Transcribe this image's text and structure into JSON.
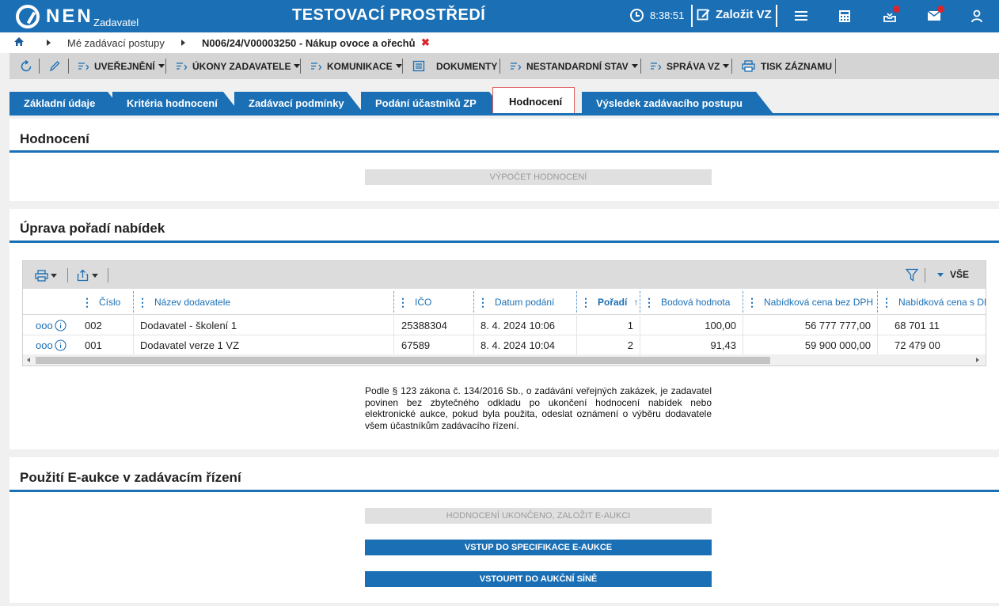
{
  "app": {
    "logo_text": "NEN",
    "logo_sub": "Zadavatel",
    "env_title": "TESTOVACÍ PROSTŘEDÍ",
    "clock": "8:38:51",
    "new_button": "Založit VZ"
  },
  "icons": [
    "clock-icon",
    "edit-icon",
    "menu-icon",
    "calculator-icon",
    "inbox-icon",
    "mail-icon",
    "user-icon",
    "home-icon",
    "refresh-icon",
    "pencil-icon",
    "printer-icon",
    "export-icon",
    "filter-icon",
    "info-icon",
    "more-icon"
  ],
  "colors": {
    "primary": "#1a6fb5",
    "notification": "#d9262c",
    "close": "#d9262c"
  },
  "breadcrumb": {
    "item1": "Mé zadávací postupy",
    "item2": "N006/24/V00003250 - Nákup ovoce a ořechů",
    "close": "✖"
  },
  "toolbar": {
    "uverejneni": "UVEŘEJNĚNÍ",
    "ukony": "ÚKONY ZADAVATELE",
    "komunikace": "KOMUNIKACE",
    "dokumenty": "DOKUMENTY",
    "nestandardni": "NESTANDARDNÍ STAV",
    "sprava": "SPRÁVA VZ",
    "tisk": "TISK ZÁZNAMU"
  },
  "tabs": [
    {
      "label": "Základní údaje"
    },
    {
      "label": "Kritéria hodnocení"
    },
    {
      "label": "Zadávací podmínky"
    },
    {
      "label": "Podání účastníků ZP"
    },
    {
      "label": "Hodnocení",
      "active": true
    },
    {
      "label": "Výsledek zadávacího postupu"
    }
  ],
  "section_hodnoceni": {
    "title": "Hodnocení",
    "button": "VÝPOČET HODNOCENÍ"
  },
  "section_poradi": {
    "title": "Úprava pořadí nabídek",
    "filter_label": "VŠE",
    "columns": [
      "Číslo",
      "Název dodavatele",
      "IČO",
      "Datum podání",
      "Pořadí",
      "Bodová hodnota",
      "Nabídková cena bez DPH",
      "Nabídková cena s DPH"
    ],
    "sort_indicator": "↑",
    "rows": [
      [
        "002",
        "Dodavatel - školení 1",
        "25388304",
        "8. 4. 2024 10:06",
        "1",
        "100,00",
        "56 777 777,00",
        "68 701 11"
      ],
      [
        "001",
        "Dodavatel verze 1 VZ",
        "67589",
        "8. 4. 2024 10:04",
        "2",
        "91,43",
        "59 900 000,00",
        "72 479 00"
      ]
    ],
    "note": "Podle § 123 zákona č. 134/2016 Sb., o zadávání veřejných zakázek, je zadavatel povinen bez zbytečného odkladu po ukončení hodnocení nabídek nebo elektronické aukce, pokud byla použita, odeslat oznámení o výběru dodavatele všem účastníkům zadávacího řízení."
  },
  "section_eaukce": {
    "title": "Použití E-aukce v zadávacím řízení",
    "btn_disabled": "HODNOCENÍ UKONČENO, ZALOŽIT E-AUKCI",
    "btn_spec": "VSTUP DO SPECIFIKACE E-AUKCE",
    "btn_sin": "VSTOUPIT DO AUKČNÍ SÍNĚ"
  }
}
